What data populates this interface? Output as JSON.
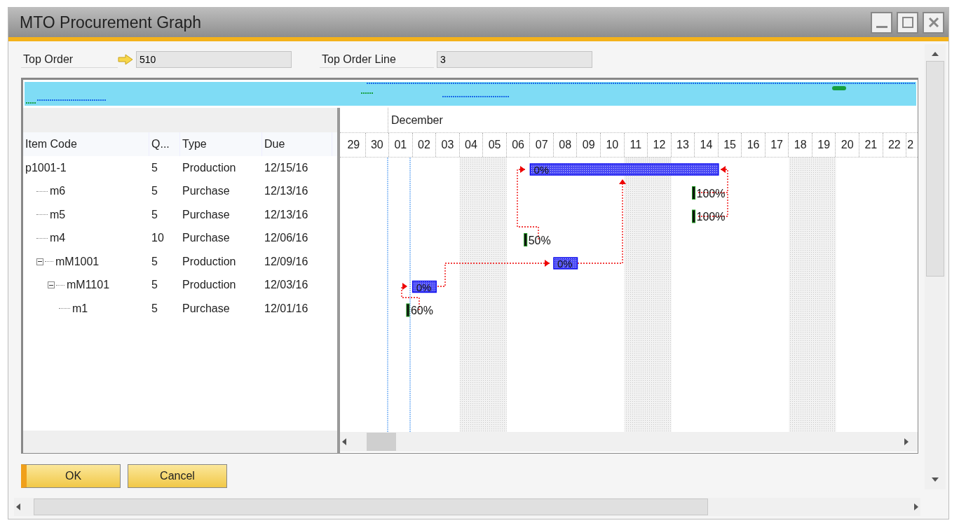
{
  "window": {
    "title": "MTO Procurement Graph"
  },
  "header_fields": [
    {
      "label": "Top Order",
      "value": "510",
      "link_arrow": true
    },
    {
      "label": "Top Order Line",
      "value": "3",
      "link_arrow": false
    }
  ],
  "grid": {
    "columns": [
      "Item Code",
      "Q...",
      "Type",
      "Due"
    ],
    "rows": [
      {
        "item_code": "p1001-1",
        "quantity": "5",
        "type": "Production",
        "due": "12/15/16",
        "kind": "production",
        "progress": "0%",
        "children": [
          {
            "item_code": "m6",
            "quantity": "5",
            "type": "Purchase",
            "due": "12/13/16",
            "kind": "purchase",
            "progress": "100%"
          },
          {
            "item_code": "m5",
            "quantity": "5",
            "type": "Purchase",
            "due": "12/13/16",
            "kind": "purchase",
            "progress": "100%"
          },
          {
            "item_code": "m4",
            "quantity": "10",
            "type": "Purchase",
            "due": "12/06/16",
            "kind": "purchase",
            "progress": "50%"
          },
          {
            "item_code": "mM1001",
            "quantity": "5",
            "type": "Production",
            "due": "12/09/16",
            "kind": "production",
            "progress": "0%",
            "expanded": true,
            "children": [
              {
                "item_code": "mM1101",
                "quantity": "5",
                "type": "Production",
                "due": "12/03/16",
                "kind": "production",
                "progress": "0%",
                "expanded": true,
                "children": [
                  {
                    "item_code": "m1",
                    "quantity": "5",
                    "type": "Purchase",
                    "due": "12/01/16",
                    "kind": "purchase",
                    "progress": "60%"
                  }
                ]
              }
            ]
          }
        ]
      }
    ]
  },
  "timeline": {
    "month": "December",
    "days": [
      "29",
      "30",
      "01",
      "02",
      "03",
      "04",
      "05",
      "06",
      "07",
      "08",
      "09",
      "10",
      "11",
      "12",
      "13",
      "14",
      "15",
      "16",
      "17",
      "18",
      "19",
      "20",
      "21",
      "22",
      "2"
    ]
  },
  "buttons": [
    {
      "label": "OK",
      "selected": true
    },
    {
      "label": "Cancel",
      "selected": false
    }
  ]
}
